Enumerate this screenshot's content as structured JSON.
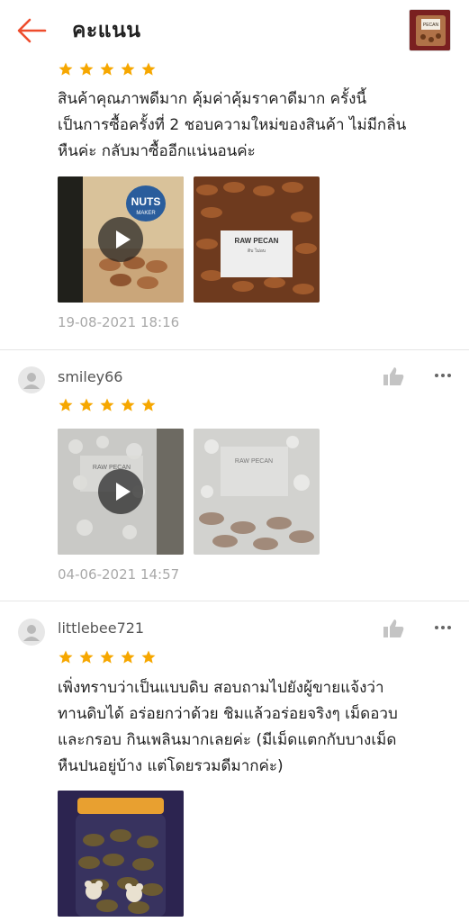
{
  "header": {
    "title": "คะแนน",
    "product_thumb_text": "PECAN"
  },
  "reviews": [
    {
      "text": "สินค้าคุณภาพดีมาก คุ้มค่าคุ้มราคาดีมาก ครั้งนี้\nเป็นการซื้อครั้งที่ 2 ชอบความใหม่ของสินค้า ไม่มีกลิ่น\nหืนค่ะ กลับมาซื้ออีกแน่นอนค่ะ",
      "rating": 5,
      "media": [
        {
          "type": "video",
          "logo_text": "NUTS",
          "logo_sub": "MAKER"
        },
        {
          "type": "image",
          "label_title": "RAW PECAN",
          "label_sub": "ดิบ ไม่อบ"
        }
      ],
      "date": "19-08-2021 18:16"
    },
    {
      "username": "smiley66",
      "rating": 5,
      "media": [
        {
          "type": "video",
          "label_title": "RAW PECAN"
        },
        {
          "type": "image",
          "label_title": "RAW PECAN"
        }
      ],
      "date": "04-06-2021 14:57"
    },
    {
      "username": "littlebee721",
      "rating": 5,
      "text": "เพิ่งทราบว่าเป็นแบบดิบ สอบถามไปยังผู้ขายแจ้งว่า\nทานดิบได้ อร่อยกว่าด้วย ชิมแล้วอร่อยจริงๆ เม็ดอวบ\nและกรอบ กินเพลินมากเลยค่ะ (มีเม็ดแตกกับบางเม็ด\nหืนปนอยู่บ้าง แต่โดยรวมดีมากค่ะ)",
      "media": [
        {
          "type": "image"
        }
      ]
    }
  ],
  "colors": {
    "accent": "#ee4d2d",
    "star": "#f6a700",
    "date": "#a9a9a9"
  },
  "icons": {
    "back": "arrow-left-icon",
    "like": "thumbs-up-icon",
    "more": "more-dots-icon",
    "avatar": "user-avatar-icon",
    "play": "play-icon",
    "star": "star-icon"
  }
}
